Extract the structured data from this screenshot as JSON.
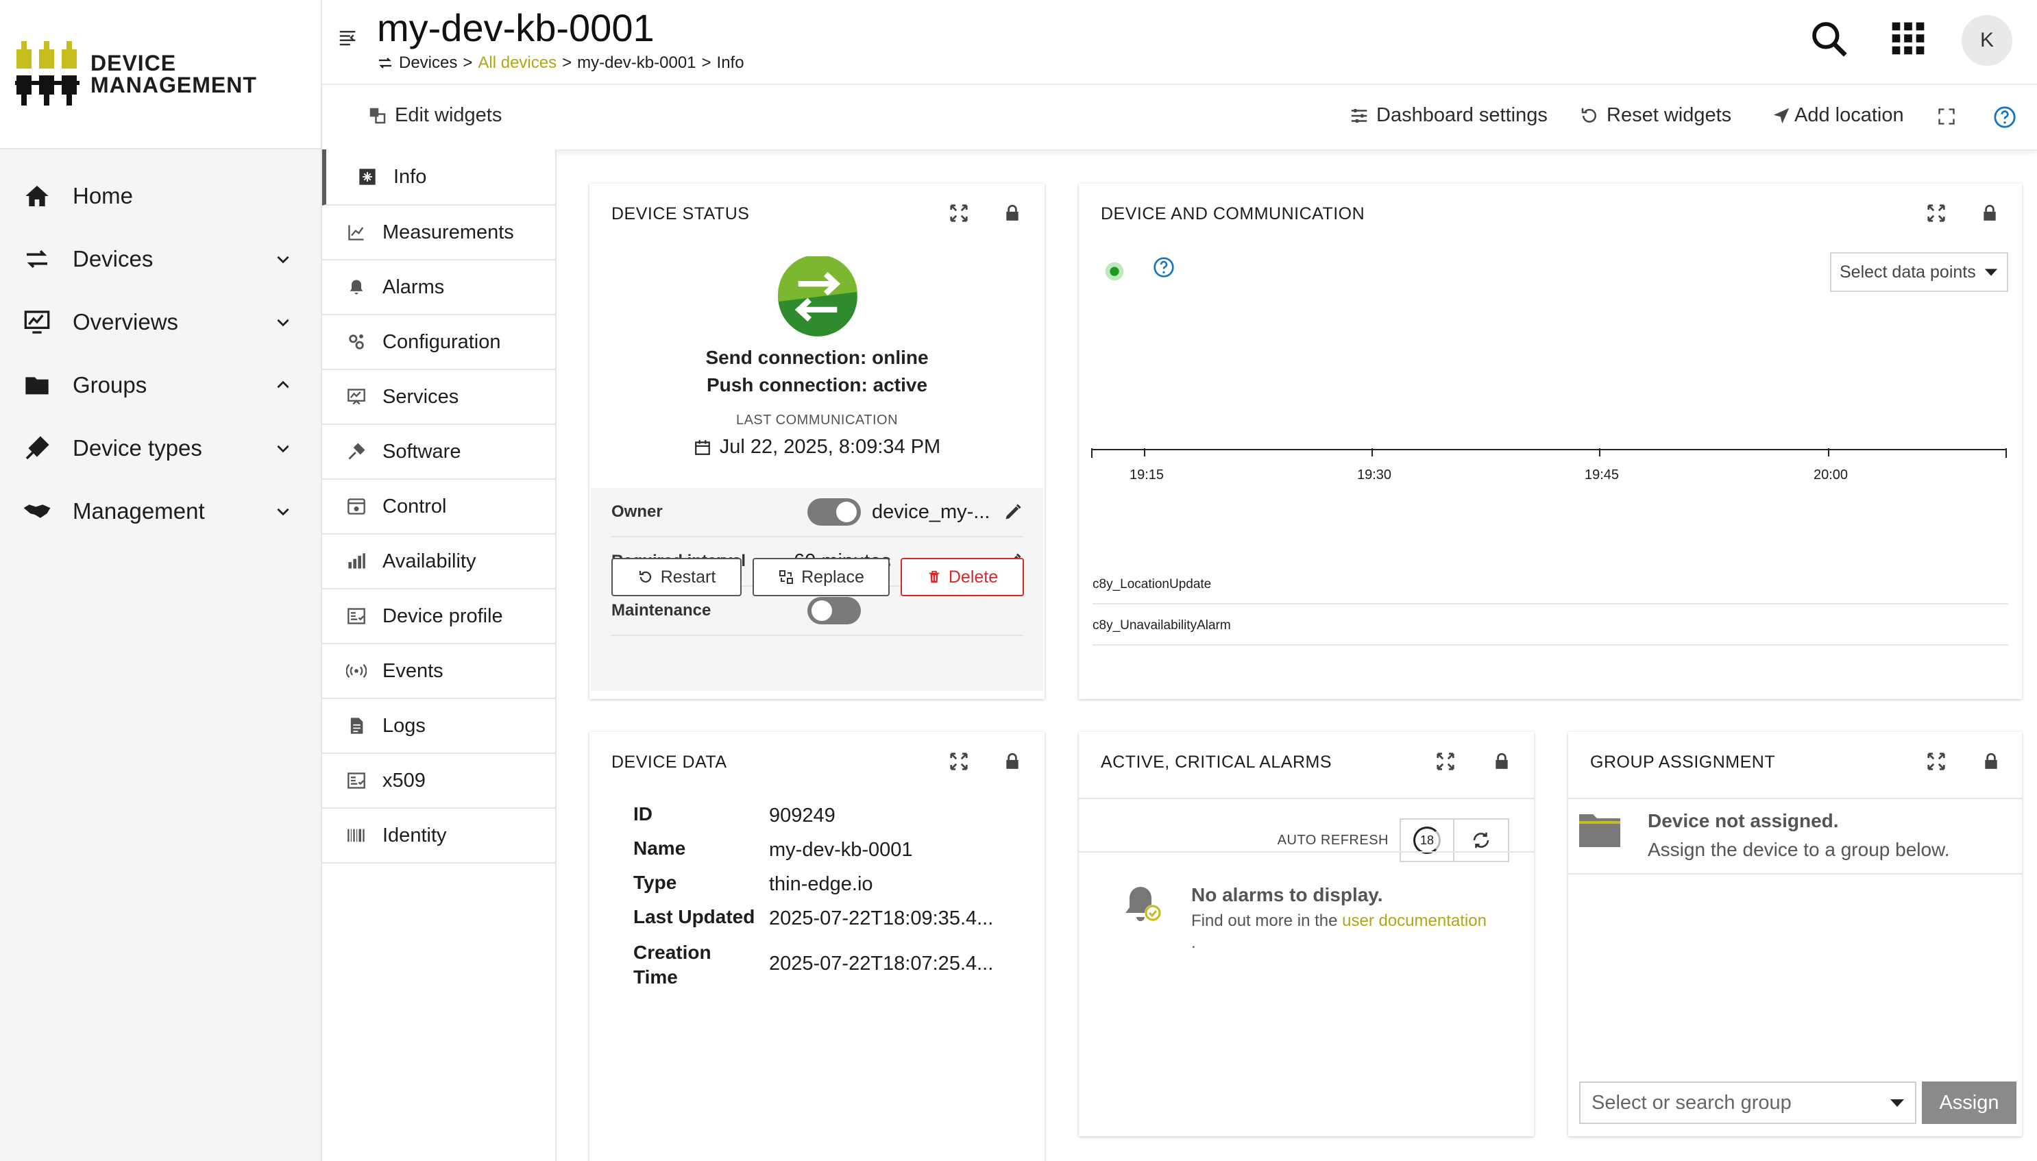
{
  "brand": {
    "line1": "DEVICE",
    "line2": "MANAGEMENT"
  },
  "nav": {
    "items": [
      {
        "label": "Home",
        "icon": "home-icon",
        "chevron": ""
      },
      {
        "label": "Devices",
        "icon": "devices-icon",
        "chevron": "down"
      },
      {
        "label": "Overviews",
        "icon": "overviews-icon",
        "chevron": "down"
      },
      {
        "label": "Groups",
        "icon": "folder-icon",
        "chevron": "up"
      },
      {
        "label": "Device types",
        "icon": "device-types-icon",
        "chevron": "down"
      },
      {
        "label": "Management",
        "icon": "handshake-icon",
        "chevron": "down"
      }
    ]
  },
  "header": {
    "title": "my-dev-kb-0001",
    "breadcrumb": {
      "root": "Devices",
      "link": "All devices",
      "device": "my-dev-kb-0001",
      "page": "Info",
      "sep": ">"
    },
    "avatar_initial": "K"
  },
  "toolbar": {
    "edit_widgets": "Edit widgets",
    "dashboard_settings": "Dashboard settings",
    "reset_widgets": "Reset widgets",
    "add_location": "Add location"
  },
  "subnav": {
    "items": [
      {
        "label": "Info",
        "icon": "info-icon"
      },
      {
        "label": "Measurements",
        "icon": "line-chart-icon"
      },
      {
        "label": "Alarms",
        "icon": "bell-icon"
      },
      {
        "label": "Configuration",
        "icon": "gears-icon"
      },
      {
        "label": "Services",
        "icon": "services-icon"
      },
      {
        "label": "Software",
        "icon": "software-icon"
      },
      {
        "label": "Control",
        "icon": "control-icon"
      },
      {
        "label": "Availability",
        "icon": "bar-chart-icon"
      },
      {
        "label": "Device profile",
        "icon": "device-profile-icon"
      },
      {
        "label": "Events",
        "icon": "events-icon"
      },
      {
        "label": "Logs",
        "icon": "document-icon"
      },
      {
        "label": "x509",
        "icon": "certificate-icon"
      },
      {
        "label": "Identity",
        "icon": "barcode-icon"
      }
    ]
  },
  "device_status": {
    "title": "DEVICE STATUS",
    "send_connection": "Send connection: online",
    "push_connection": "Push connection: active",
    "last_comm_label": "LAST COMMUNICATION",
    "last_comm_value": "Jul 22, 2025, 8:09:34 PM",
    "owner_label": "Owner",
    "owner_value": "device_my-...",
    "interval_label": "Required interval",
    "interval_value": "60 minutes",
    "maintenance_label": "Maintenance",
    "restart": "Restart",
    "replace": "Replace",
    "delete": "Delete",
    "colors": {
      "online": "#2e8b2e",
      "danger": "#d62828"
    }
  },
  "device_comm": {
    "title": "DEVICE AND COMMUNICATION",
    "select_label": "Select data points",
    "ticks": [
      "19:15",
      "19:30",
      "19:45",
      "20:00"
    ],
    "series": [
      "c8y_LocationUpdate",
      "c8y_UnavailabilityAlarm"
    ]
  },
  "device_data": {
    "title": "DEVICE DATA",
    "rows": [
      {
        "label": "ID",
        "value": "909249"
      },
      {
        "label": "Name",
        "value": "my-dev-kb-0001"
      },
      {
        "label": "Type",
        "value": "thin-edge.io"
      },
      {
        "label": "Last Updated",
        "value": "2025-07-22T18:09:35.4..."
      },
      {
        "label": "Creation Time",
        "value": "2025-07-22T18:07:25.4..."
      }
    ]
  },
  "alarms": {
    "title": "ACTIVE, CRITICAL ALARMS",
    "auto_refresh": "AUTO REFRESH",
    "refresh_seconds": "18",
    "empty_title": "No alarms to display.",
    "empty_text": "Find out more in the",
    "empty_link": "user documentation",
    "empty_dot": "."
  },
  "group_assignment": {
    "title": "GROUP ASSIGNMENT",
    "message_title": "Device not assigned.",
    "message_text": "Assign the device to a group below.",
    "select_placeholder": "Select or search group",
    "assign": "Assign"
  }
}
